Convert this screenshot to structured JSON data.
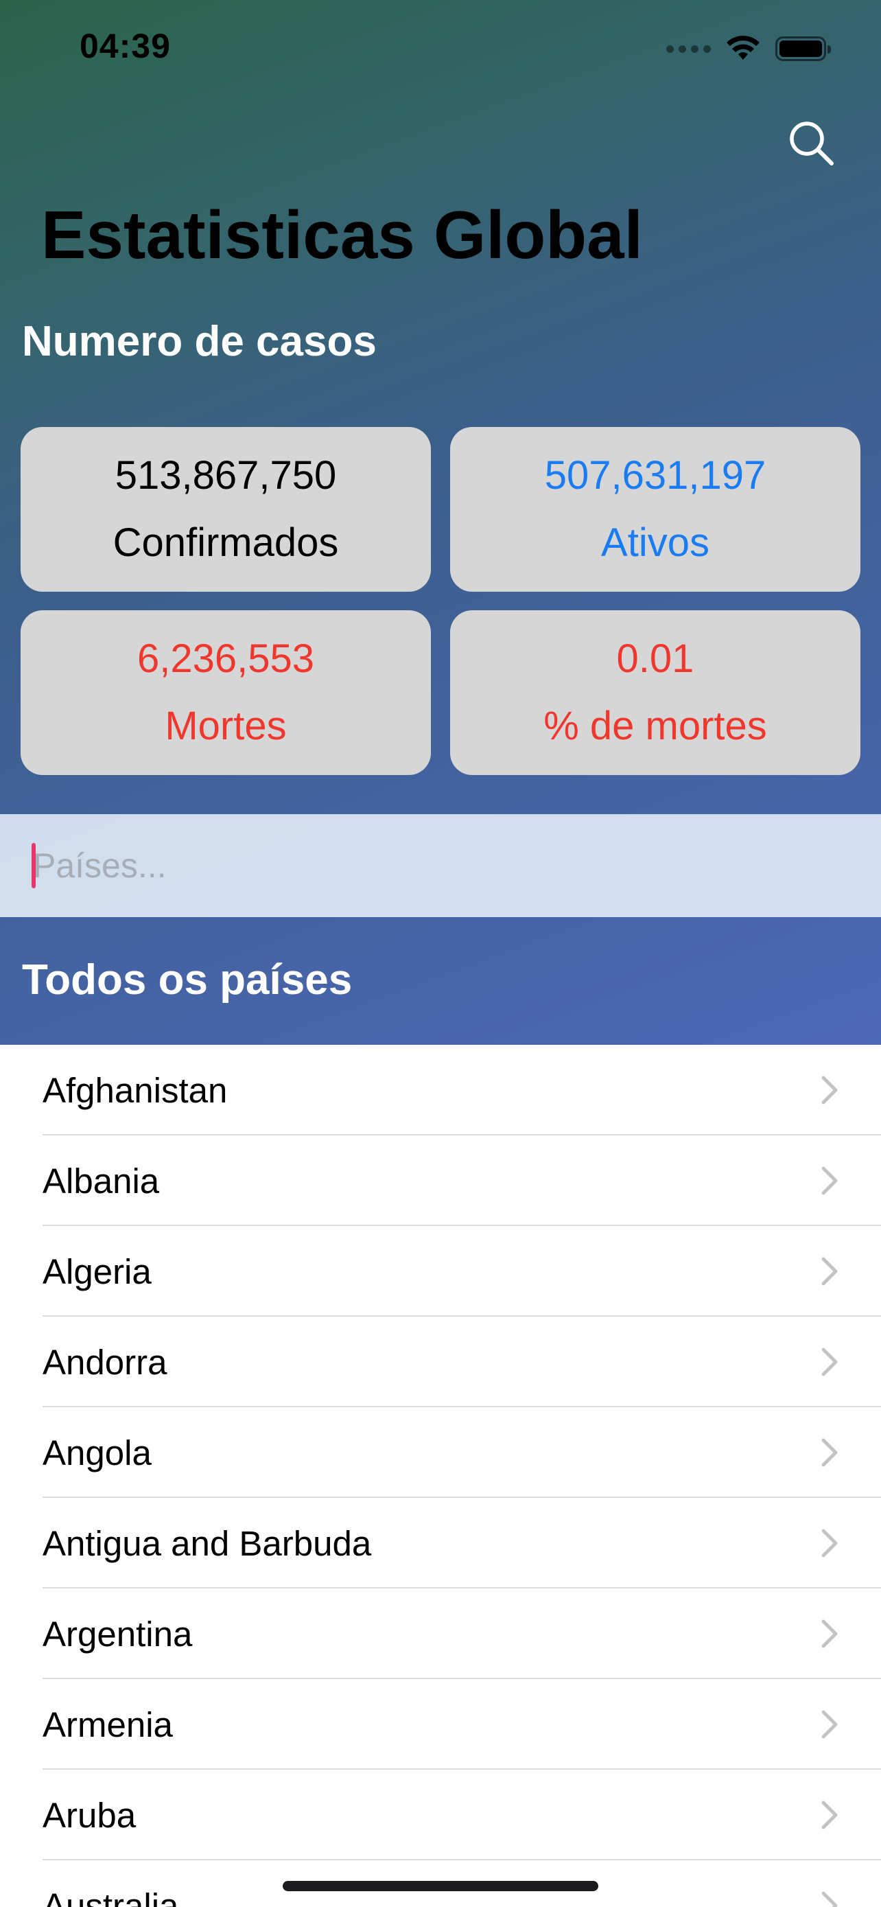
{
  "status_bar": {
    "time": "04:39"
  },
  "header": {
    "title": "Estatisticas Global",
    "cases_heading": "Numero de casos"
  },
  "stats": {
    "confirmed": {
      "value": "513,867,750",
      "label": "Confirmados",
      "color": "#000000"
    },
    "active": {
      "value": "507,631,197",
      "label": "Ativos",
      "color": "#1a7cf2"
    },
    "deaths": {
      "value": "6,236,553",
      "label": "Mortes",
      "color": "#f0372d"
    },
    "death_rate": {
      "value": "0.01",
      "label": "% de mortes",
      "color": "#f0372d"
    }
  },
  "search": {
    "placeholder": "Países...",
    "value": ""
  },
  "countries": {
    "heading": "Todos os países",
    "items": [
      "Afghanistan",
      "Albania",
      "Algeria",
      "Andorra",
      "Angola",
      "Antigua and Barbuda",
      "Argentina",
      "Armenia",
      "Aruba",
      "Australia"
    ]
  },
  "icons": {
    "search": "search-icon",
    "chevron": "chevron-right-icon",
    "wifi": "wifi-icon",
    "battery": "battery-icon",
    "signal": "cellular-signal-icon"
  }
}
